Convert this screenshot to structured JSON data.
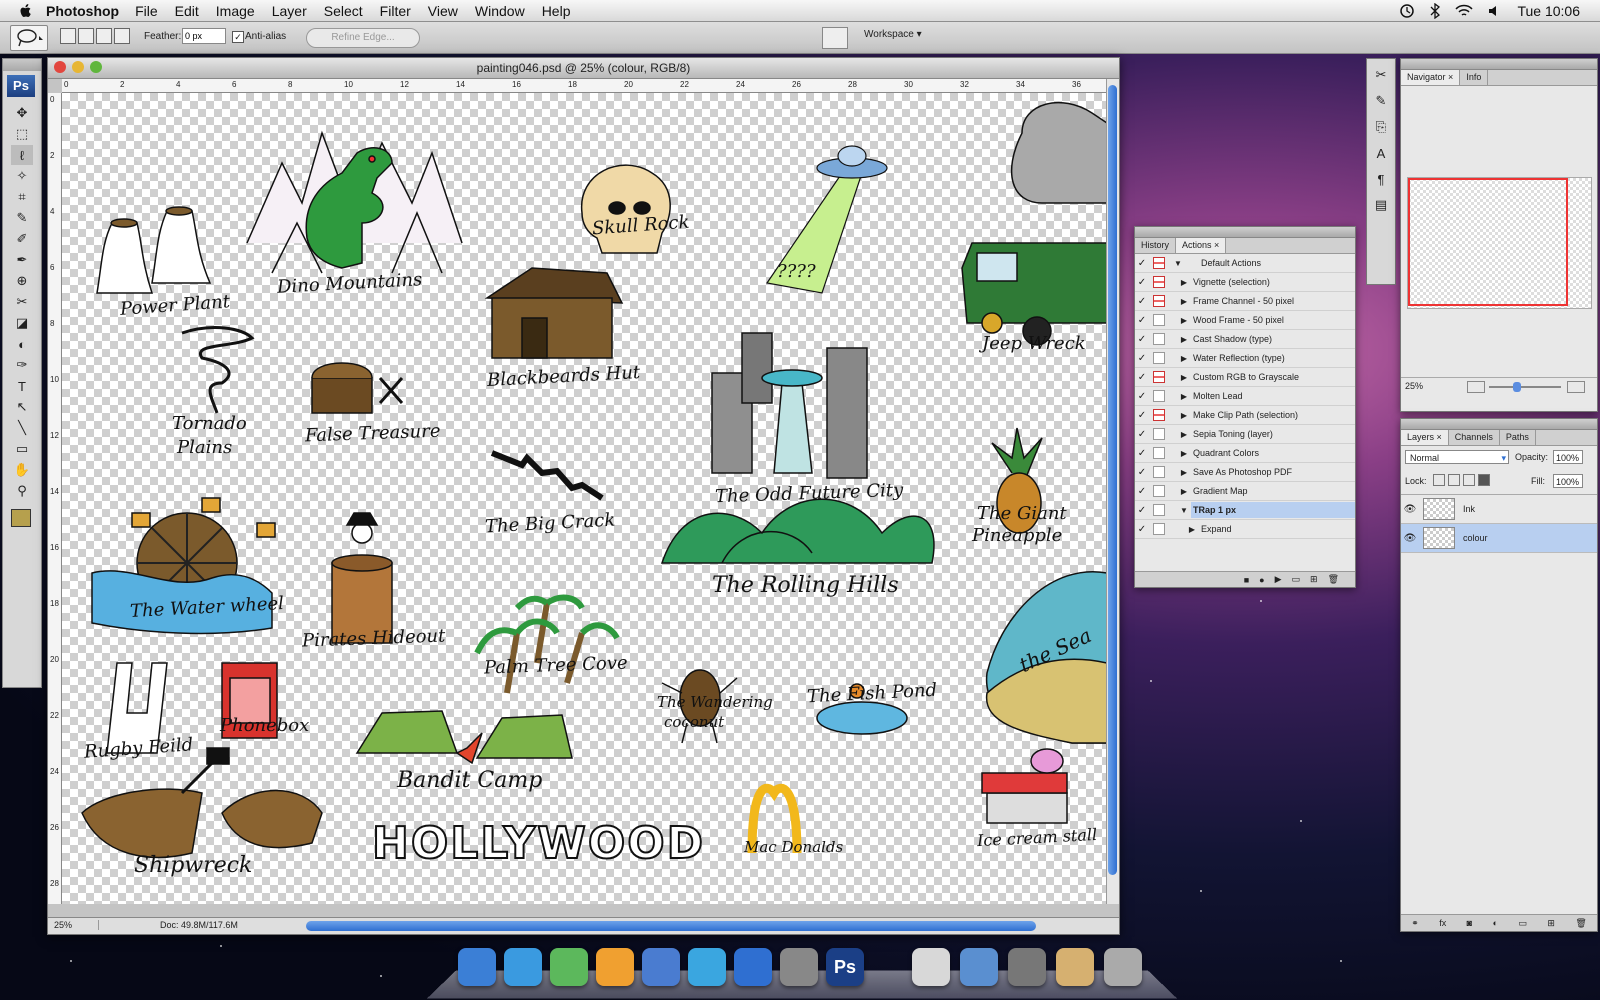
{
  "menubar": {
    "app_name": "Photoshop",
    "items": [
      "File",
      "Edit",
      "Image",
      "Layer",
      "Select",
      "Filter",
      "View",
      "Window",
      "Help"
    ],
    "clock": "Tue 10:06"
  },
  "options_bar": {
    "feather_label": "Feather:",
    "feather_value": "0 px",
    "antialias_label": "Anti-alias",
    "antialias_checked": "✓",
    "refine_edge": "Refine Edge...",
    "workspace": "Workspace"
  },
  "tools": {
    "logo": "Ps",
    "glyphs": [
      "✥",
      "⬚",
      "ℓ",
      "✧",
      "⌗",
      "✎",
      "✐",
      "✒",
      "⊕",
      "✂",
      "◪",
      "◐",
      "✑",
      "T",
      "↖",
      "╲",
      "▭",
      "✋",
      "⚲"
    ],
    "foreground_color": "#b6a04d"
  },
  "document": {
    "title": "painting046.psd @ 25% (colour, RGB/8)",
    "ruler_top": [
      "0",
      "2",
      "4",
      "6",
      "8",
      "10",
      "12",
      "14",
      "16",
      "18",
      "20",
      "22",
      "24",
      "26",
      "28",
      "30",
      "32",
      "34",
      "36"
    ],
    "ruler_left": [
      "0",
      "2",
      "4",
      "6",
      "8",
      "10",
      "12",
      "14",
      "16",
      "18",
      "20",
      "22",
      "24",
      "26",
      "28"
    ],
    "zoom": "25%",
    "doc_info": "Doc: 49.8M/117.6M",
    "labels": {
      "dino": "Dino Mountains",
      "skull": "Skull Rock",
      "ufo": "????",
      "power": "Power Plant",
      "hut": "Blackbeards Hut",
      "jeep": "Jeep Wreck",
      "tornado1": "Tornado",
      "tornado2": "Plains",
      "treasure": "False Treasure",
      "city": "The Odd Future City",
      "pineapple1": "The Giant",
      "pineapple2": "Pineapple",
      "crack": "The Big Crack",
      "water": "The Water wheel",
      "pirates": "Pirates Hideout",
      "hills": "The Rolling Hills",
      "palm": "Palm Tree Cove",
      "sea": "the Sea",
      "coconut1": "The Wandering",
      "coconut2": "coconut",
      "fish": "The Fish Pond",
      "rugby": "Rugby Feild",
      "phone": "Phonebox",
      "bandit": "Bandit Camp",
      "ship": "Shipwreck",
      "holly": "HOLLYWOOD",
      "mac": "Mac Donalds",
      "ice": "Ice cream stall"
    }
  },
  "actions_panel": {
    "tabs": [
      "History",
      "Actions"
    ],
    "rows": [
      {
        "name": "Default Actions",
        "red": true,
        "folder": true,
        "open": true
      },
      {
        "name": "Vignette (selection)",
        "red": true
      },
      {
        "name": "Frame Channel - 50 pixel",
        "red": true
      },
      {
        "name": "Wood Frame - 50 pixel",
        "red": false
      },
      {
        "name": "Cast Shadow (type)",
        "red": false
      },
      {
        "name": "Water Reflection (type)",
        "red": false
      },
      {
        "name": "Custom RGB to Grayscale",
        "red": true
      },
      {
        "name": "Molten Lead",
        "red": false
      },
      {
        "name": "Make Clip Path (selection)",
        "red": true
      },
      {
        "name": "Sepia Toning (layer)",
        "red": false
      },
      {
        "name": "Quadrant Colors",
        "red": false
      },
      {
        "name": "Save As Photoshop PDF",
        "red": false
      },
      {
        "name": "Gradient Map",
        "red": false
      },
      {
        "name": "TRap 1 px",
        "red": false,
        "selected": true,
        "open": true
      },
      {
        "name": "Expand",
        "red": false,
        "child": true
      }
    ]
  },
  "navigator_panel": {
    "tabs": [
      "Navigator",
      "Info"
    ],
    "zoom": "25%"
  },
  "layers_panel": {
    "tabs": [
      "Layers",
      "Channels",
      "Paths"
    ],
    "blend_mode": "Normal",
    "opacity_label": "Opacity:",
    "opacity": "100%",
    "lock_label": "Lock:",
    "fill_label": "Fill:",
    "fill": "100%",
    "layers": [
      {
        "name": "Ink",
        "selected": false
      },
      {
        "name": "colour",
        "selected": true
      }
    ]
  },
  "dock": {
    "apps": [
      "Finder",
      "Safari",
      "Network",
      "Pages",
      "Word",
      "QuickTime",
      "Front Row",
      "System Prefs",
      "Photoshop",
      "Preview",
      "Applications",
      "Movies",
      "Pictures",
      "Trash"
    ],
    "ps_label": "Ps"
  }
}
